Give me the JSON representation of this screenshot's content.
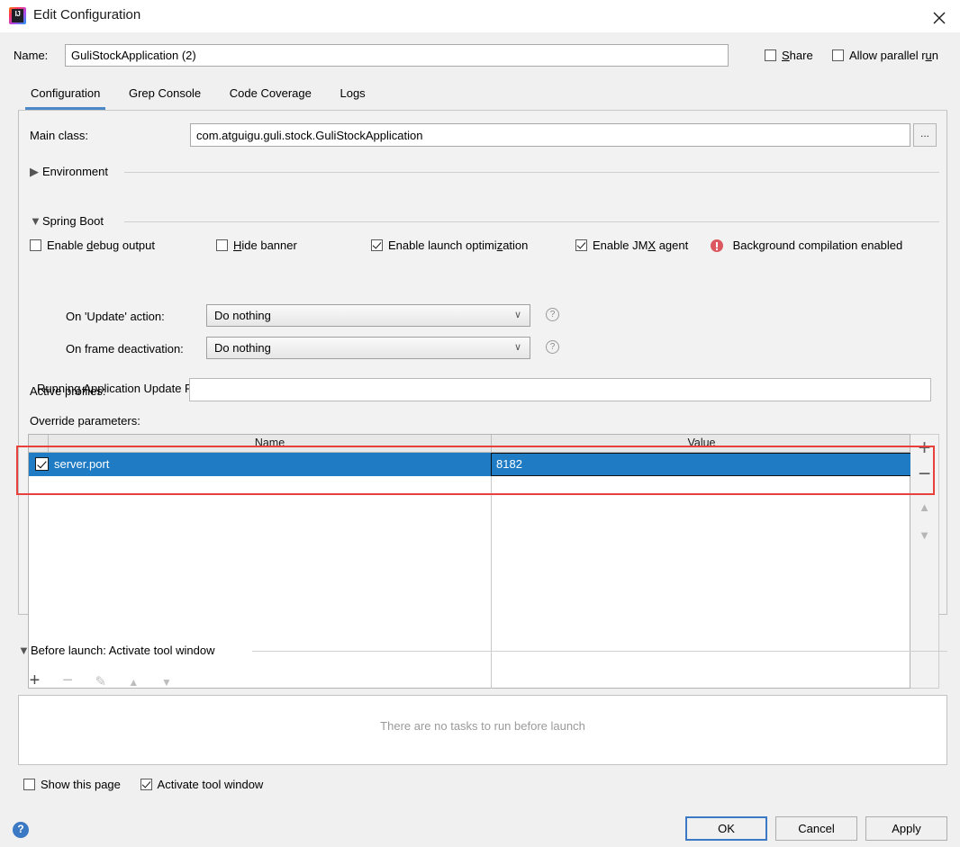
{
  "window": {
    "title": "Edit Configuration",
    "logo_icon": "intellij-idea-logo",
    "close_icon": "close-icon"
  },
  "name_row": {
    "label": "Name:",
    "value": "GuliStockApplication (2)",
    "share_label": "Share",
    "share_checked": false,
    "allow_parallel_label": "Allow parallel run",
    "allow_parallel_checked": false
  },
  "tabs": [
    {
      "label": "Configuration",
      "active": true
    },
    {
      "label": "Grep Console",
      "active": false
    },
    {
      "label": "Code Coverage",
      "active": false
    },
    {
      "label": "Logs",
      "active": false
    }
  ],
  "main_class": {
    "label": "Main class:",
    "value": "com.atguigu.guli.stock.GuliStockApplication",
    "browse_label": "...",
    "browse_icon": "ellipsis-icon"
  },
  "environment_section": {
    "label": "Environment",
    "expanded": false,
    "triangle": "▶"
  },
  "spring_boot_section": {
    "label": "Spring Boot",
    "expanded": true,
    "triangle": "▼",
    "options": [
      {
        "label_pre": "Enable ",
        "mnemonic": "d",
        "label_post": "ebug output",
        "checked": false
      },
      {
        "label_pre": "",
        "mnemonic": "H",
        "label_post": "ide banner",
        "checked": false
      },
      {
        "label_pre": "Enable launch optimi",
        "mnemonic": "z",
        "label_post": "ation",
        "checked": true
      },
      {
        "label_pre": "Enable JM",
        "mnemonic": "X",
        "label_post": " agent",
        "checked": true
      }
    ],
    "warning_text": "Background compilation enabled",
    "warning_icon": "error-circle-icon"
  },
  "update_policies": {
    "group_title": "Running Application Update Policies",
    "on_update_label": "On 'Update' action:",
    "on_update_value": "Do nothing",
    "on_frame_label": "On frame deactivation:",
    "on_frame_value": "Do nothing",
    "help_icon": "question-mark-icon",
    "help_label": "?",
    "chevron": "∨"
  },
  "active_profiles": {
    "label": "Active profiles:",
    "value": "",
    "placeholder": ""
  },
  "override_parameters": {
    "label": "Override parameters:",
    "columns": [
      "Name",
      "Value"
    ],
    "rows": [
      {
        "enabled": true,
        "name": "server.port",
        "value": "8182",
        "selected": true
      }
    ],
    "toolbar": {
      "add_label": "+",
      "remove_label": "−",
      "up_label": "▲",
      "down_label": "▼"
    }
  },
  "before_launch": {
    "label": "Before launch: Activate tool window",
    "triangle": "▼",
    "toolbar": {
      "add_label": "+",
      "remove_label": "−",
      "edit_label": "✎",
      "up_label": "▲",
      "down_label": "▼"
    },
    "empty_text": "There are no tasks to run before launch",
    "show_this_page_label": "Show this page",
    "show_this_page_checked": false,
    "activate_tool_window_label": "Activate tool window",
    "activate_tool_window_checked": true
  },
  "footer": {
    "help_icon": "help-circle-icon",
    "help_label": "?",
    "ok_label": "OK",
    "cancel_label": "Cancel",
    "apply_label": "Apply"
  },
  "colors": {
    "accent_blue": "#1e7bc4",
    "tab_underline": "#4a88c7",
    "error_red": "#db5860",
    "annotation_red": "#e8413c"
  }
}
